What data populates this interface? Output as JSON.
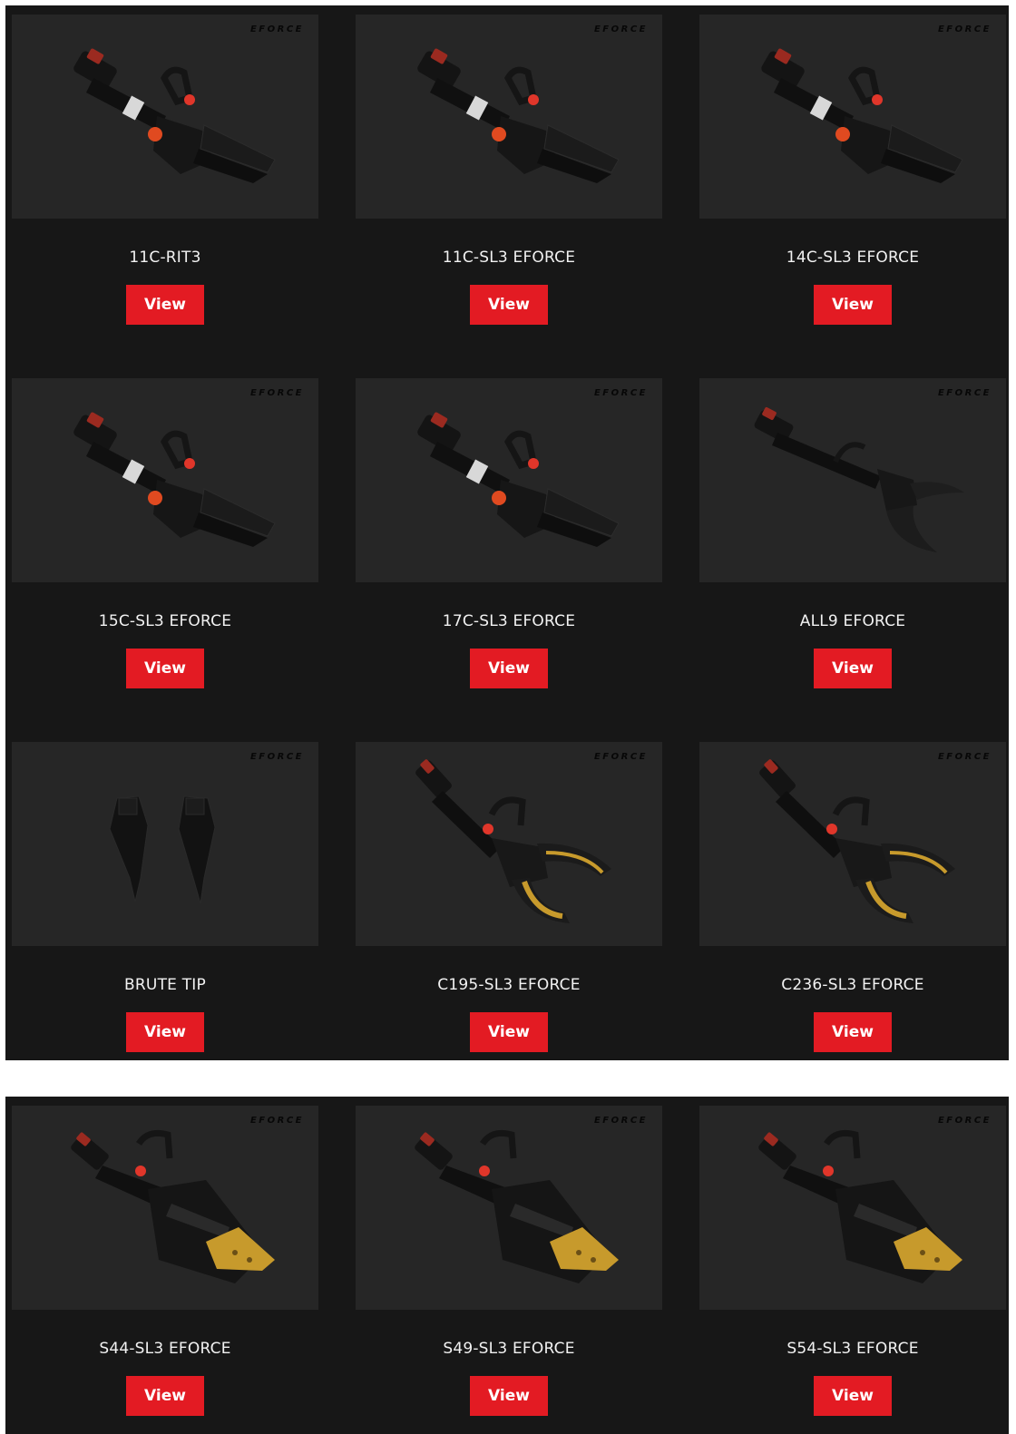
{
  "brand_mark": "EFORCE",
  "view_label": "View",
  "colors": {
    "section_bg": "#171717",
    "thumb_bg": "#262626",
    "button": "#e31b23",
    "tool_jaw_gold": "#c79a2c"
  },
  "sections": [
    {
      "products": [
        {
          "name": "11C-RIT3",
          "tool_type": "combi"
        },
        {
          "name": "11C-SL3 EFORCE",
          "tool_type": "combi"
        },
        {
          "name": "14C-SL3 EFORCE",
          "tool_type": "combi"
        },
        {
          "name": "15C-SL3 EFORCE",
          "tool_type": "combi"
        },
        {
          "name": "17C-SL3 EFORCE",
          "tool_type": "combi"
        },
        {
          "name": "ALL9 EFORCE",
          "tool_type": "cutter"
        },
        {
          "name": "BRUTE TIP",
          "tool_type": "tips"
        },
        {
          "name": "C195-SL3 EFORCE",
          "tool_type": "cutter-gold"
        },
        {
          "name": "C236-SL3 EFORCE",
          "tool_type": "cutter-gold"
        }
      ]
    },
    {
      "products": [
        {
          "name": "S44-SL3 EFORCE",
          "tool_type": "spreader-gold"
        },
        {
          "name": "S49-SL3 EFORCE",
          "tool_type": "spreader-gold"
        },
        {
          "name": "S54-SL3 EFORCE",
          "tool_type": "spreader-gold"
        }
      ]
    }
  ]
}
